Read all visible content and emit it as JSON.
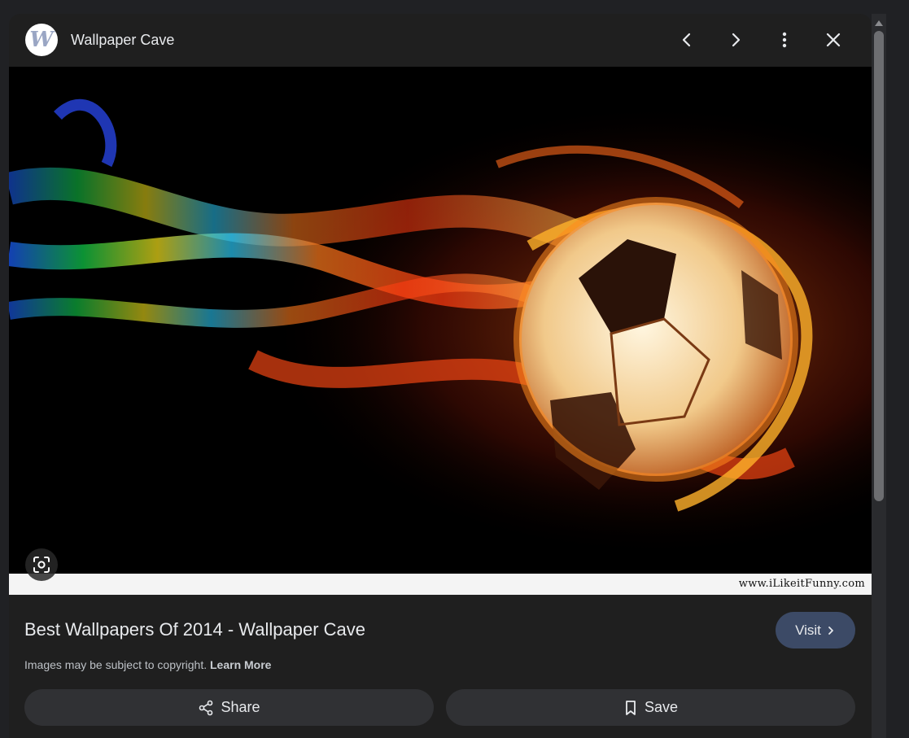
{
  "header": {
    "logo_letter": "W",
    "site_name": "Wallpaper Cave",
    "icons": [
      "chevron-left-icon",
      "chevron-right-icon",
      "more-vert-icon",
      "close-icon"
    ]
  },
  "image": {
    "watermark": "www.iLikeitFunny.com",
    "lens_icon": "google-lens-icon"
  },
  "details": {
    "title": "Best Wallpapers Of 2014 - Wallpaper Cave",
    "visit_label": "Visit",
    "copyright_text": "Images may be subject to copyright.",
    "learn_more": "Learn More"
  },
  "actions": {
    "share_label": "Share",
    "save_label": "Save"
  },
  "colors": {
    "background": "#202124",
    "panel": "#1f1f1f",
    "visit_button": "#3c4a66",
    "action_button": "#303134"
  }
}
